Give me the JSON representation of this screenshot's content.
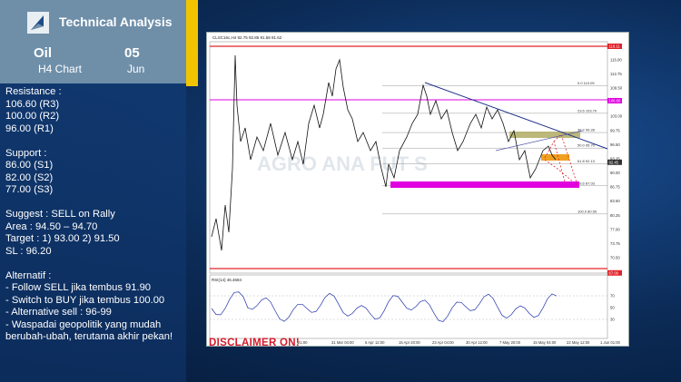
{
  "header": {
    "brand": "Technical Analysis",
    "symbol": "Oil",
    "timeframe": "H4 Chart",
    "day": "05",
    "month": "Jun"
  },
  "analysis": {
    "resistance_label": "Resistance :",
    "resistance": [
      "106.60 (R3)",
      "100.00 (R2)",
      "96.00 (R1)"
    ],
    "support_label": "Support :",
    "support": [
      "86.00 (S1)",
      "82.00 (S2)",
      "77.00 (S3)"
    ],
    "suggest": "Suggest : SELL on Rally",
    "area": "Area : 94.50 – 94.70",
    "target": "Target : 1) 93.00 2) 91.50",
    "sl": "SL : 96.20",
    "alternatif_label": "Alternatif :",
    "alternatif": [
      "- Follow SELL jika tembus  91.90",
      "- Switch to BUY jika tembus 100.00",
      "- Alternative sell : 96-99",
      "- Waspadai geopolitik yang mudah berubah-ubah, terutama akhir pekan!"
    ]
  },
  "chart": {
    "symbol_info": "CLSC16c,H4  92.75 92.85 91.58 91.62",
    "price_ticks": [
      "119.11",
      "116.00",
      "112.75",
      "109.50",
      "106.25",
      "103.00",
      "99.75",
      "96.50",
      "93.25",
      "90.00",
      "86.75",
      "83.50",
      "80.25",
      "77.00",
      "73.75",
      "70.50"
    ],
    "price_badges": [
      "119.11",
      "106.60",
      "92.45",
      "67.00"
    ],
    "fib_levels": [
      {
        "pct": "0.0",
        "price": "110.05"
      },
      {
        "pct": "23.6",
        "price": "103.70"
      },
      {
        "pct": "38.2",
        "price": "99.28"
      },
      {
        "pct": "50.0",
        "price": "95.70"
      },
      {
        "pct": "61.8",
        "price": "92.13"
      },
      {
        "pct": "78.6",
        "price": "87.03"
      },
      {
        "pct": "100.0",
        "price": "80.55"
      }
    ],
    "time_ticks": [
      "21:00",
      "31 Mar 04:00",
      "6 Apr 12:00",
      "15 Apr 20:00",
      "23 Apr 04:00",
      "30 Apr 12:00",
      "7 May 20:00",
      "15 May 04:00",
      "22 May 12:00",
      "1 Jun 01:00"
    ],
    "rsi_label": "RSI(14) 46.4684",
    "rsi_ticks": [
      "70",
      "50",
      "30"
    ],
    "watermark": "AGRO  ANA  FUT  S",
    "colors": {
      "resistance": "#e0242c",
      "magenta": "#e000e0",
      "olive": "#b5b06a",
      "orange": "#f0a020",
      "line": "#1a1a1a",
      "trend": "#1d2f8c"
    }
  },
  "disclaimer": "DISCLAIMER ON!"
}
